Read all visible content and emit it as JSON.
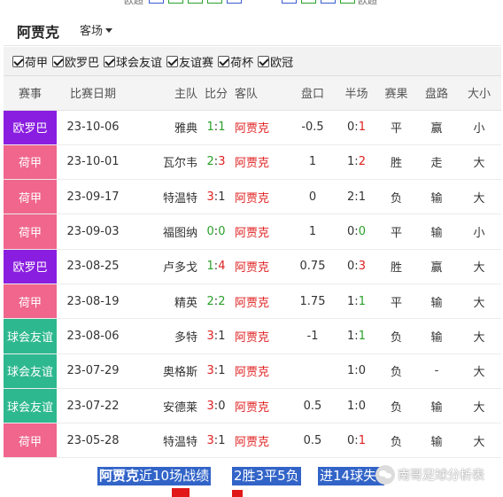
{
  "top_strip": {
    "left_label": "欧超",
    "right_label": "欧超"
  },
  "header": {
    "team": "阿贾克",
    "venue_select": "客场"
  },
  "filters": [
    {
      "label": "荷甲",
      "checked": true
    },
    {
      "label": "欧罗巴",
      "checked": true
    },
    {
      "label": "球会友谊",
      "checked": true
    },
    {
      "label": "友谊赛",
      "checked": true
    },
    {
      "label": "荷杯",
      "checked": true
    },
    {
      "label": "欧冠",
      "checked": true
    }
  ],
  "columns": [
    "赛事",
    "比赛日期",
    "主队",
    "比分",
    "客队",
    "盘口",
    "半场",
    "赛果",
    "盘路",
    "大小"
  ],
  "colors": {
    "eredivisie": "#f0668c",
    "europa": "#8a1ee0",
    "friendly": "#2eb88f",
    "highlight": "#3264c8"
  },
  "rows": [
    {
      "comp": "欧罗巴",
      "comp_color": "#8a1ee0",
      "date": "23-10-06",
      "home": "雅典",
      "score_h": "1",
      "score_a": "1",
      "away": "阿贾克",
      "handicap": "-0.5",
      "half_h": "0",
      "half_a": "1",
      "result": "平",
      "pan": "赢",
      "ou": "小"
    },
    {
      "comp": "荷甲",
      "comp_color": "#f0668c",
      "date": "23-10-01",
      "home": "瓦尔韦",
      "score_h": "2",
      "score_a": "3",
      "away": "阿贾克",
      "handicap": "1",
      "half_h": "1",
      "half_a": "2",
      "result": "胜",
      "pan": "走",
      "ou": "大"
    },
    {
      "comp": "荷甲",
      "comp_color": "#f0668c",
      "date": "23-09-17",
      "home": "特温特",
      "score_h": "3",
      "score_a": "1",
      "away": "阿贾克",
      "handicap": "0",
      "half_h": "2",
      "half_a": "1",
      "result": "负",
      "pan": "输",
      "ou": "大"
    },
    {
      "comp": "荷甲",
      "comp_color": "#f0668c",
      "date": "23-09-03",
      "home": "福图纳",
      "score_h": "0",
      "score_a": "0",
      "away": "阿贾克",
      "handicap": "1",
      "half_h": "0",
      "half_a": "0",
      "result": "平",
      "pan": "输",
      "ou": "小"
    },
    {
      "comp": "欧罗巴",
      "comp_color": "#8a1ee0",
      "date": "23-08-25",
      "home": "卢多戈",
      "score_h": "1",
      "score_a": "4",
      "away": "阿贾克",
      "handicap": "0.75",
      "half_h": "0",
      "half_a": "3",
      "result": "胜",
      "pan": "赢",
      "ou": "大"
    },
    {
      "comp": "荷甲",
      "comp_color": "#f0668c",
      "date": "23-08-19",
      "home": "精英",
      "score_h": "2",
      "score_a": "2",
      "away": "阿贾克",
      "handicap": "1.75",
      "half_h": "1",
      "half_a": "1",
      "result": "平",
      "pan": "输",
      "ou": "大"
    },
    {
      "comp": "球会友谊",
      "comp_color": "#2eb88f",
      "date": "23-08-06",
      "home": "多特",
      "score_h": "3",
      "score_a": "1",
      "away": "阿贾克",
      "handicap": "-1",
      "half_h": "1",
      "half_a": "1",
      "result": "负",
      "pan": "输",
      "ou": "大"
    },
    {
      "comp": "球会友谊",
      "comp_color": "#2eb88f",
      "date": "23-07-29",
      "home": "奥格斯",
      "score_h": "3",
      "score_a": "1",
      "away": "阿贾克",
      "handicap": "",
      "half_h": "1",
      "half_a": "0",
      "result": "负",
      "pan": "-",
      "ou": "大"
    },
    {
      "comp": "球会友谊",
      "comp_color": "#2eb88f",
      "date": "23-07-22",
      "home": "安德莱",
      "score_h": "3",
      "score_a": "0",
      "away": "阿贾克",
      "handicap": "0.5",
      "half_h": "1",
      "half_a": "0",
      "result": "负",
      "pan": "输",
      "ou": "大"
    },
    {
      "comp": "荷甲",
      "comp_color": "#f0668c",
      "date": "23-05-28",
      "home": "特温特",
      "score_h": "3",
      "score_a": "1",
      "away": "阿贾克",
      "handicap": "0.5",
      "half_h": "0",
      "half_a": "1",
      "result": "负",
      "pan": "输",
      "ou": "大"
    }
  ],
  "footer": {
    "team": "阿贾克",
    "recent": "近10场战绩",
    "record": "2胜3平5负",
    "goals": "进14球失",
    "watermark": "南哥足球分析表"
  }
}
